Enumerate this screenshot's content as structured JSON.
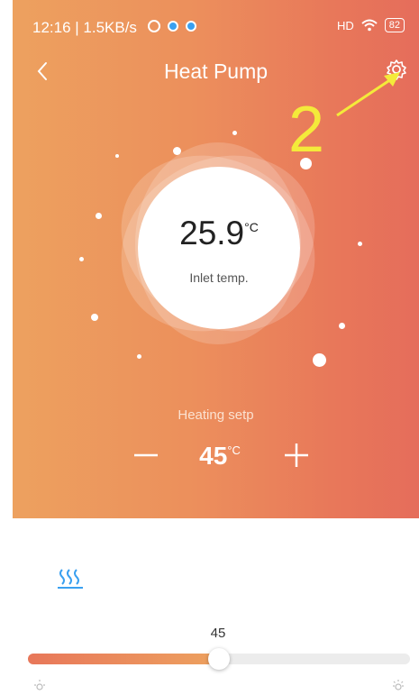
{
  "status": {
    "time_speed": "12:16 | 1.5KB/s",
    "signal": "HD",
    "battery": "82"
  },
  "header": {
    "title": "Heat Pump"
  },
  "annotation": {
    "number": "2",
    "color": "#f4ea3a"
  },
  "inlet": {
    "value": "25.9",
    "unit": "°C",
    "label": "Inlet temp."
  },
  "setpoint": {
    "label": "Heating setp",
    "value": "45",
    "unit": "°C"
  },
  "slider": {
    "value": "45",
    "fraction": 0.5
  },
  "icons": {
    "back": "chevron-left-icon",
    "settings": "gear-icon",
    "mode": "heating-waves-icon",
    "minus": "minus-icon",
    "plus": "plus-icon",
    "sun_left": "sun-low-icon",
    "sun_right": "sun-high-icon"
  },
  "colors": {
    "accent": "#3aa0f0",
    "gradient_start": "#eda15f",
    "gradient_end": "#e56d5b"
  }
}
